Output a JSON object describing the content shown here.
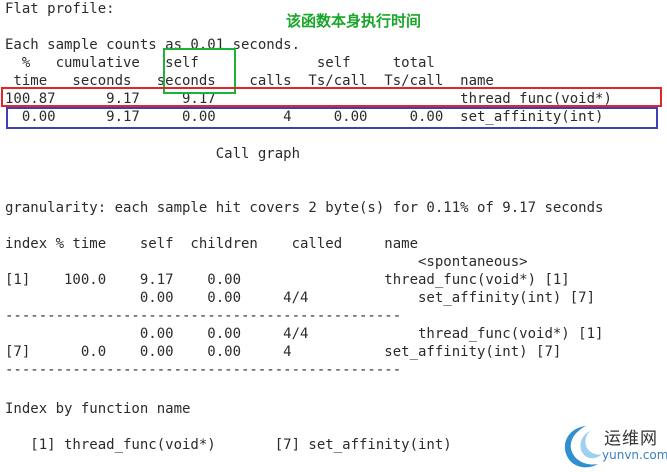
{
  "annotation": "该函数本身执行时间",
  "lines": [
    "Flat profile:",
    "",
    "Each sample counts as 0.01 seconds.",
    "  %   cumulative   self              self     total",
    " time   seconds   seconds    calls  Ts/call  Ts/call  name",
    "100.87      9.17     9.17                             thread_func(void*)",
    "  0.00      9.17     0.00        4     0.00     0.00  set_affinity(int)",
    "",
    "                         Call graph",
    "",
    "",
    "granularity: each sample hit covers 2 byte(s) for 0.11% of 9.17 seconds",
    "",
    "index % time    self  children    called     name",
    "                                                 <spontaneous>",
    "[1]    100.0    9.17    0.00                 thread_func(void*) [1]",
    "                0.00    0.00     4/4             set_affinity(int) [7]",
    "-----------------------------------------------",
    "                0.00    0.00     4/4             thread_func(void*) [1]",
    "[7]      0.0    0.00    0.00     4           set_affinity(int) [7]",
    "-----------------------------------------------",
    "",
    "Index by function name",
    "",
    "   [1] thread_func(void*)       [7] set_affinity(int)"
  ],
  "highlights": {
    "green": {
      "label": "self seconds column",
      "color": "#1db33a"
    },
    "red": {
      "label": "thread_func row",
      "color": "#e3262a"
    },
    "blue": {
      "label": "set_affinity row",
      "color": "#3b3fb8"
    }
  },
  "watermark": {
    "title": "运维网",
    "url": "yunvn.com"
  }
}
